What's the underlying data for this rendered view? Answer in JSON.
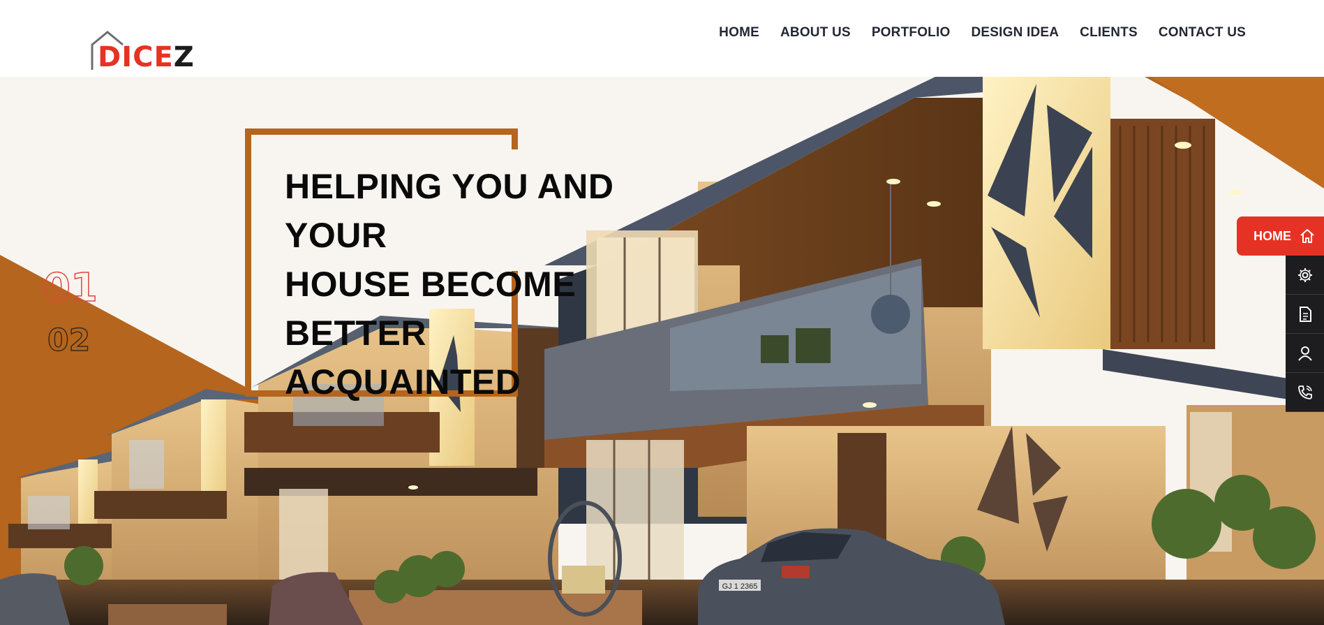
{
  "header": {
    "logo": {
      "text_red": "DICE",
      "text_dark": "Z"
    },
    "nav": [
      {
        "label": "HOME"
      },
      {
        "label": "ABOUT US"
      },
      {
        "label": "PORTFOLIO"
      },
      {
        "label": "DESIGN IDEA"
      },
      {
        "label": "CLIENTS"
      },
      {
        "label": "CONTACT US"
      }
    ]
  },
  "hero": {
    "headline": [
      "HELPING YOU AND YOUR",
      "HOUSE BECOME BETTER",
      "ACQUAINTED"
    ],
    "slides": [
      "01",
      "02"
    ],
    "active_slide": "01",
    "car_plate": "GJ 1 2365"
  },
  "side_menu": {
    "active_label": "HOME",
    "items": [
      {
        "icon": "home-icon"
      },
      {
        "icon": "gear-icon"
      },
      {
        "icon": "document-icon"
      },
      {
        "icon": "user-icon"
      },
      {
        "icon": "phone-icon"
      }
    ]
  },
  "colors": {
    "accent_red": "#e63224",
    "accent_bronze": "#b5651d",
    "nav_text": "#222733",
    "side_dark": "#1d1d1f"
  }
}
